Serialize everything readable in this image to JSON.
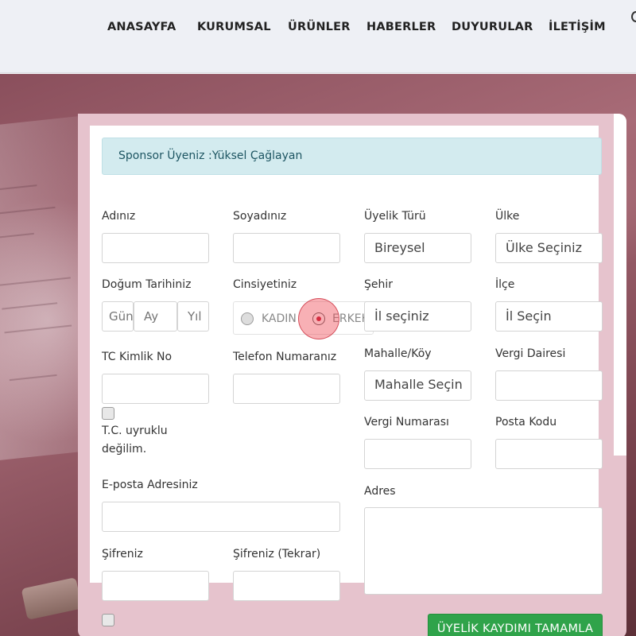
{
  "nav": {
    "items": [
      "ANASAYFA",
      "KURUMSAL",
      "ÜRÜNLER",
      "HABERLER",
      "DUYURULAR",
      "İLETİŞİM"
    ]
  },
  "alert": {
    "sponsor_text": "Sponsor Üyeniz :Yüksel Çağlayan"
  },
  "form": {
    "first_name_label": "Adınız",
    "last_name_label": "Soyadınız",
    "membership_type_label": "Üyelik Türü",
    "membership_type_value": "Bireysel",
    "country_label": "Ülke",
    "country_value": "Ülke Seçiniz",
    "birth_date_label": "Doğum Tarihiniz",
    "birth_day_placeholder": "Gün",
    "birth_month_placeholder": "Ay",
    "birth_year_placeholder": "Yıl",
    "gender_label": "Cinsiyetiniz",
    "gender_female": "KADIN",
    "gender_male": "ERKEK",
    "gender_selected": "ERKEK",
    "city_label": "Şehir",
    "city_value": "İl seçiniz",
    "district_label": "İlçe",
    "district_value": "İl Seçin",
    "tc_label": "TC Kimlik No",
    "phone_label": "Telefon Numaranız",
    "neighborhood_label": "Mahalle/Köy",
    "neighborhood_value": "Mahalle Seçin",
    "tax_office_label": "Vergi Dairesi",
    "not_tc_line1": "T.C. uyruklu",
    "not_tc_line2": "değilim.",
    "tax_number_label": "Vergi Numarası",
    "postal_code_label": "Posta Kodu",
    "email_label": "E-posta Adresiniz",
    "address_label": "Adres",
    "password_label": "Şifreniz",
    "password_repeat_label": "Şifreniz (Tekrar)",
    "submit_label": "ÜYELİK KAYDIMI TAMAMLA"
  },
  "colors": {
    "alert_bg": "#d3ebef",
    "submit_bg": "#2fa34a",
    "card_border": "#e6c3cd",
    "radio_selected": "#c0102a"
  }
}
